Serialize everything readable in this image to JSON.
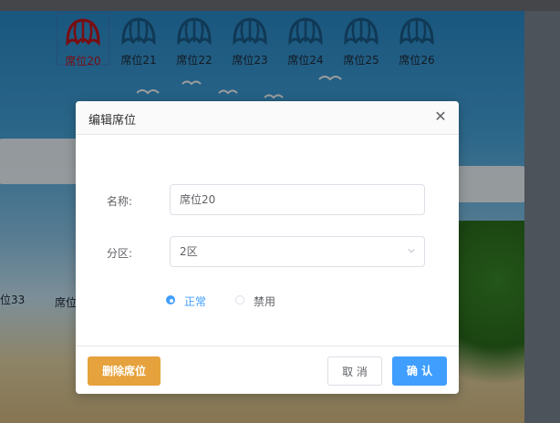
{
  "seats": [
    {
      "label": "席位20",
      "selected": true
    },
    {
      "label": "席位21",
      "selected": false
    },
    {
      "label": "席位22",
      "selected": false
    },
    {
      "label": "席位23",
      "selected": false
    },
    {
      "label": "席位24",
      "selected": false
    },
    {
      "label": "席位25",
      "selected": false
    },
    {
      "label": "席位26",
      "selected": false
    }
  ],
  "side_seats": {
    "seat_33": "位33",
    "seat_partial": "席位"
  },
  "dialog": {
    "title": "编辑席位",
    "close_icon": "close-icon",
    "name_label": "名称:",
    "name_value": "席位20",
    "zone_label": "分区:",
    "zone_value": "2区",
    "status_options": [
      {
        "label": "正常",
        "checked": true
      },
      {
        "label": "禁用",
        "checked": false
      }
    ],
    "delete_button": "删除席位",
    "cancel_button": "取 消",
    "confirm_button": "确 认"
  },
  "colors": {
    "primary": "#409eff",
    "warning": "#e6a23c",
    "selected_seat": "#c3161c",
    "seat_icon": "#1a5c8c"
  }
}
